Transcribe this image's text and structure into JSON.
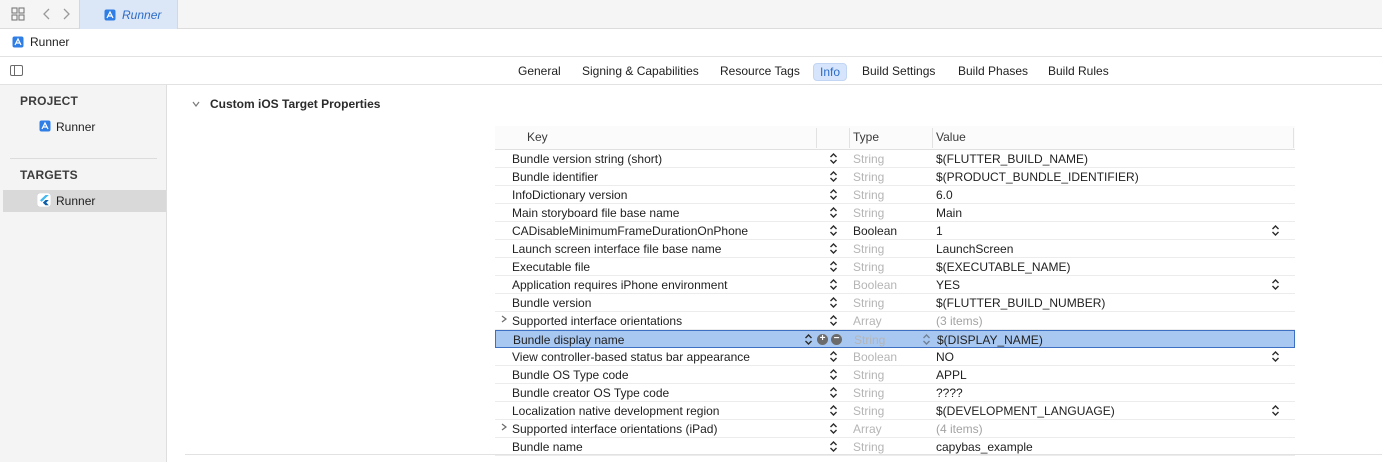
{
  "window": {
    "tab_title": "Runner",
    "breadcrumb": "Runner"
  },
  "editor_tabs": [
    {
      "label": "General",
      "active": false
    },
    {
      "label": "Signing & Capabilities",
      "active": false
    },
    {
      "label": "Resource Tags",
      "active": false
    },
    {
      "label": "Info",
      "active": true
    },
    {
      "label": "Build Settings",
      "active": false
    },
    {
      "label": "Build Phases",
      "active": false
    },
    {
      "label": "Build Rules",
      "active": false
    }
  ],
  "sidebar": {
    "project_heading": "PROJECT",
    "project_item": "Runner",
    "targets_heading": "TARGETS",
    "target_item": "Runner"
  },
  "section": {
    "title": "Custom iOS Target Properties"
  },
  "table": {
    "headers": {
      "key": "Key",
      "type": "Type",
      "value": "Value"
    },
    "rows": [
      {
        "key": "Bundle version string (short)",
        "type": "String",
        "value": "$(FLUTTER_BUILD_NAME)"
      },
      {
        "key": "Bundle identifier",
        "type": "String",
        "value": "$(PRODUCT_BUNDLE_IDENTIFIER)"
      },
      {
        "key": "InfoDictionary version",
        "type": "String",
        "value": "6.0"
      },
      {
        "key": "Main storyboard file base name",
        "type": "String",
        "value": "Main"
      },
      {
        "key": "CADisableMinimumFrameDurationOnPhone",
        "type": "Boolean",
        "value": "1",
        "type_dark": true,
        "value_stepper": true
      },
      {
        "key": "Launch screen interface file base name",
        "type": "String",
        "value": "LaunchScreen"
      },
      {
        "key": "Executable file",
        "type": "String",
        "value": "$(EXECUTABLE_NAME)"
      },
      {
        "key": "Application requires iPhone environment",
        "type": "Boolean",
        "value": "YES",
        "value_stepper": true
      },
      {
        "key": "Bundle version",
        "type": "String",
        "value": "$(FLUTTER_BUILD_NUMBER)"
      },
      {
        "key": "Supported interface orientations",
        "type": "Array",
        "value": "(3 items)",
        "disclosure": true,
        "value_muted": true
      },
      {
        "key": "Bundle display name",
        "type": "String",
        "value": "$(DISPLAY_NAME)",
        "selected": true
      },
      {
        "key": "View controller-based status bar appearance",
        "type": "Boolean",
        "value": "NO",
        "value_stepper": true
      },
      {
        "key": "Bundle OS Type code",
        "type": "String",
        "value": "APPL"
      },
      {
        "key": "Bundle creator OS Type code",
        "type": "String",
        "value": "????"
      },
      {
        "key": "Localization native development region",
        "type": "String",
        "value": "$(DEVELOPMENT_LANGUAGE)",
        "value_stepper": true
      },
      {
        "key": "Supported interface orientations (iPad)",
        "type": "Array",
        "value": "(4 items)",
        "disclosure": true,
        "value_muted": true
      },
      {
        "key": "Bundle name",
        "type": "String",
        "value": "capybas_example"
      }
    ]
  },
  "colors": {
    "accent": "#2d6cc8",
    "selected_row": "#a9c8f1",
    "sidebar_bg": "#f4f4f4"
  }
}
